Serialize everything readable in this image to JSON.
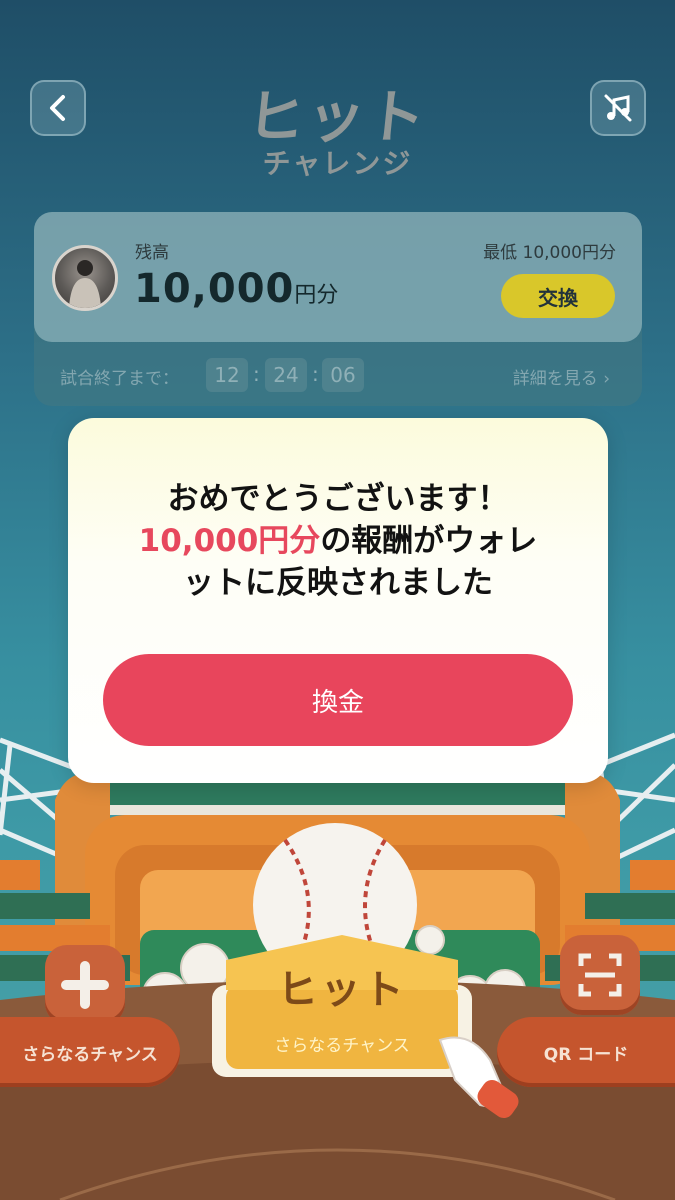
{
  "header": {
    "logo_main": "ヒット",
    "logo_sub": "チャレンジ",
    "back_icon": "chevron-left-icon",
    "music_icon": "music-off-icon"
  },
  "balance_card": {
    "label": "残高",
    "amount": "10,000",
    "unit": "円分",
    "minimum": "最低 10,000円分",
    "exchange_label": "交換",
    "timer_label": "試合終了まで：",
    "timer": {
      "hours": "12",
      "minutes": "24",
      "seconds": "06"
    },
    "details_link": "詳細を見る ›"
  },
  "modal": {
    "line1": "おめでとうございます！",
    "highlight": "10,000円分",
    "line2_rest": "の報酬がウォレ",
    "line3": "ットに反映されました",
    "button_label": "換金"
  },
  "controls": {
    "left_pill": "さらなるチャンス",
    "right_pill": "QR コード",
    "hit_label": "ヒット",
    "hit_sub": "さらなるチャンス"
  },
  "colors": {
    "accent_red": "#e8455c",
    "exchange_yellow": "#d9c72a",
    "bg_teal": "#2d7088"
  }
}
